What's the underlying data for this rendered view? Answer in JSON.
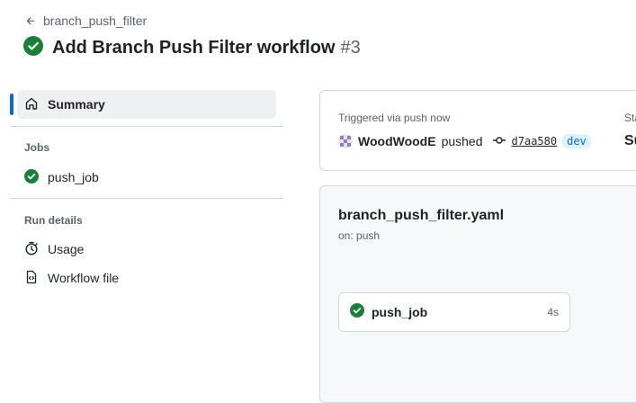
{
  "header": {
    "back_label": "branch_push_filter",
    "title": "Add Branch Push Filter workflow",
    "run_number": "#3"
  },
  "sidebar": {
    "summary_label": "Summary",
    "jobs_heading": "Jobs",
    "jobs": [
      {
        "name": "push_job",
        "status": "success"
      }
    ],
    "run_details_heading": "Run details",
    "usage_label": "Usage",
    "workflow_file_label": "Workflow file"
  },
  "summary": {
    "trigger_label": "Triggered via push now",
    "actor": "WoodWoodE",
    "action": "pushed",
    "commit_sha": "d7aa580",
    "branch": "dev",
    "status_label": "Sta",
    "status_value": "Su"
  },
  "workflow_graph": {
    "file_name": "branch_push_filter.yaml",
    "trigger": "on: push",
    "job": {
      "name": "push_job",
      "duration": "4s",
      "status": "success"
    }
  },
  "colors": {
    "success": "#1a7f37",
    "accent": "#0969da",
    "muted_text": "#59636e",
    "border": "#d1d9e0"
  },
  "icons": [
    "arrow-left-icon",
    "check-circle-fill-icon",
    "home-icon",
    "stopwatch-icon",
    "file-code-icon",
    "git-commit-icon"
  ]
}
